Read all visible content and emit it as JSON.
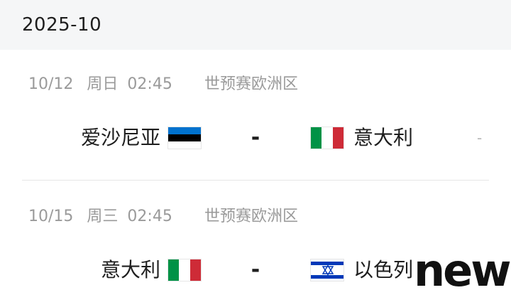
{
  "month_header": "2025-10",
  "matches": [
    {
      "date": "10/12",
      "weekday": "周日",
      "time": "02:45",
      "competition": "世预赛欧洲区",
      "home": {
        "name": "爱沙尼亚",
        "flag": "estonia-flag-icon"
      },
      "away": {
        "name": "意大利",
        "flag": "italy-flag-icon"
      },
      "score": "-",
      "status": "-"
    },
    {
      "date": "10/15",
      "weekday": "周三",
      "time": "02:45",
      "competition": "世预赛欧洲区",
      "home": {
        "name": "意大利",
        "flag": "italy-flag-icon"
      },
      "away": {
        "name": "以色列",
        "flag": "israel-flag-icon"
      },
      "score": "-"
    }
  ],
  "watermark": "news",
  "colors": {
    "header_bg": "#f5f6f7",
    "meta_text": "#9a9a9a",
    "primary_text": "#1e1e1e",
    "divider": "#e6e6e6"
  }
}
